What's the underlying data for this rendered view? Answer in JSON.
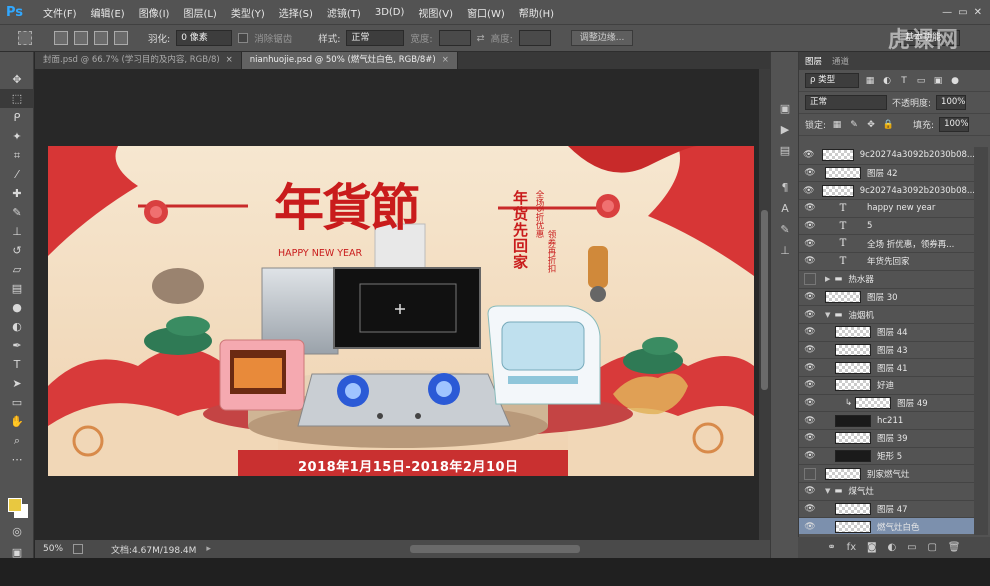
{
  "app": {
    "logo": "Ps",
    "watermark": "虎课网"
  },
  "menu": [
    "文件(F)",
    "编辑(E)",
    "图像(I)",
    "图层(L)",
    "类型(Y)",
    "选择(S)",
    "滤镜(T)",
    "3D(D)",
    "视图(V)",
    "窗口(W)",
    "帮助(H)"
  ],
  "window_controls": [
    "—",
    "▭",
    "✕"
  ],
  "options": {
    "feather_label": "羽化:",
    "feather_value": "0 像素",
    "antialias_label": "消除锯齿",
    "style_label": "样式:",
    "style_value": "正常",
    "width_label": "宽度:",
    "height_label": "高度:",
    "refine_button": "调整边缘...",
    "workspace": "基本功能"
  },
  "tabs": [
    {
      "label": "封面.psd @ 66.7% (学习目的及内容, RGB/8)",
      "close": "×",
      "active": false
    },
    {
      "label": "nianhuojie.psd @ 50% (燃气灶白色, RGB/8#)",
      "close": "×",
      "active": true
    }
  ],
  "status": {
    "zoom": "50%",
    "doc": "文档:4.67M/198.4M"
  },
  "banner": {
    "title": "年貨節",
    "happy": "HAPPY NEW YEAR",
    "vertical_main": "年货先回家",
    "vertical_small_1": "全场5折优惠",
    "vertical_small_2": "领券再折扣",
    "date": "2018年1月15日-2018年2月10日"
  },
  "panel": {
    "tabs": [
      "图层",
      "通道"
    ],
    "filter_label": "ρ 类型",
    "blend_mode": "正常",
    "opacity_label": "不透明度:",
    "opacity_value": "100%",
    "lock_label": "锁定:",
    "fill_label": "填充:",
    "fill_value": "100%"
  },
  "layers": [
    {
      "name": "9c20274a3092b2030b08...",
      "kind": "image",
      "visible": true,
      "indent": 0
    },
    {
      "name": "图层 42",
      "kind": "image",
      "visible": true,
      "indent": 0
    },
    {
      "name": "9c20274a3092b2030b08...",
      "kind": "image",
      "visible": true,
      "indent": 0
    },
    {
      "name": "happy new year",
      "kind": "text",
      "visible": true,
      "indent": 0
    },
    {
      "name": "5",
      "kind": "text",
      "visible": true,
      "indent": 0
    },
    {
      "name": "全场  折优惠，领券再...",
      "kind": "text",
      "visible": true,
      "indent": 0
    },
    {
      "name": "年货先回家",
      "kind": "text",
      "visible": true,
      "indent": 0
    },
    {
      "name": "热水器",
      "kind": "folder-closed",
      "visible": false,
      "indent": 0
    },
    {
      "name": "图层 30",
      "kind": "image",
      "visible": true,
      "indent": 0
    },
    {
      "name": "油烟机",
      "kind": "folder-open",
      "visible": true,
      "indent": 0
    },
    {
      "name": "图层 44",
      "kind": "image",
      "visible": true,
      "indent": 1
    },
    {
      "name": "图层 43",
      "kind": "image",
      "visible": true,
      "indent": 1
    },
    {
      "name": "图层 41",
      "kind": "image",
      "visible": true,
      "indent": 1
    },
    {
      "name": "好迪",
      "kind": "image",
      "visible": true,
      "indent": 1
    },
    {
      "name": "图层 49",
      "kind": "image-clip",
      "visible": true,
      "indent": 2
    },
    {
      "name": "hc211",
      "kind": "image-dark",
      "visible": true,
      "indent": 1
    },
    {
      "name": "图层 39",
      "kind": "image",
      "visible": true,
      "indent": 1
    },
    {
      "name": "矩形 5",
      "kind": "image-dark",
      "visible": true,
      "indent": 1
    },
    {
      "name": "别家燃气灶",
      "kind": "image",
      "visible": false,
      "indent": 0
    },
    {
      "name": "煤气灶",
      "kind": "folder-open",
      "visible": true,
      "indent": 0
    },
    {
      "name": "图层 47",
      "kind": "image",
      "visible": true,
      "indent": 1
    },
    {
      "name": "燃气灶白色",
      "kind": "image",
      "visible": true,
      "indent": 1,
      "selected": true
    }
  ],
  "icons": {
    "tools": [
      "move-icon",
      "marquee-icon",
      "lasso-icon",
      "magic-wand-icon",
      "crop-icon",
      "eyedropper-icon",
      "healing-icon",
      "brush-icon",
      "stamp-icon",
      "history-brush-icon",
      "eraser-icon",
      "gradient-icon",
      "blur-icon",
      "dodge-icon",
      "pen-icon",
      "type-icon",
      "path-select-icon",
      "shape-icon",
      "hand-icon",
      "zoom-icon"
    ],
    "panel_bottom": [
      "link-icon",
      "fx-icon",
      "mask-icon",
      "adjustment-icon",
      "group-icon",
      "new-layer-icon",
      "trash-icon"
    ]
  },
  "colors": {
    "foreground": "#e8c840",
    "background": "#ffffff",
    "banner_red": "#c91c1c",
    "selected_layer": "#7c90ad"
  }
}
